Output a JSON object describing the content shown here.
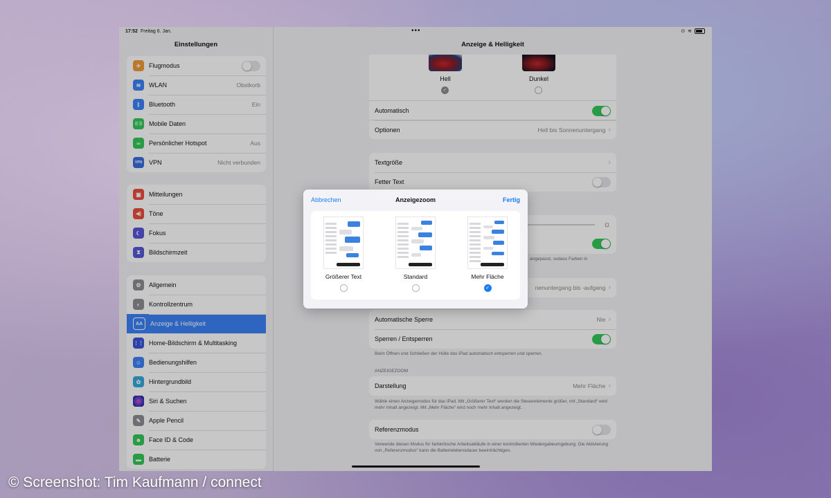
{
  "status_bar": {
    "time": "17:52",
    "date": "Freitag 6. Jan.",
    "dots": "•••"
  },
  "sidebar": {
    "title": "Einstellungen",
    "group1": [
      {
        "label": "Flugmodus",
        "value": "",
        "icon": "airplane-icon",
        "color": "#f09a37",
        "glyph": "✈"
      },
      {
        "label": "WLAN",
        "value": "Obstkorb",
        "icon": "wifi-icon",
        "color": "#3a82f7",
        "glyph": "≋"
      },
      {
        "label": "Bluetooth",
        "value": "Ein",
        "icon": "bluetooth-icon",
        "color": "#3a82f7",
        "glyph": "ᛒ"
      },
      {
        "label": "Mobile Daten",
        "value": "",
        "icon": "antenna-icon",
        "color": "#34c759",
        "glyph": "((·))"
      },
      {
        "label": "Persönlicher Hotspot",
        "value": "Aus",
        "icon": "hotspot-icon",
        "color": "#34c759",
        "glyph": "∞"
      },
      {
        "label": "VPN",
        "value": "Nicht verbunden",
        "icon": "vpn-icon",
        "color": "#3a6de0",
        "glyph": "VPN"
      }
    ],
    "group2": [
      {
        "label": "Mitteilungen",
        "icon": "notifications-icon",
        "color": "#eb4d3d",
        "glyph": "▣"
      },
      {
        "label": "Töne",
        "icon": "speaker-icon",
        "color": "#eb4d3d",
        "glyph": "◀)"
      },
      {
        "label": "Fokus",
        "icon": "moon-icon",
        "color": "#5856d6",
        "glyph": "☾"
      },
      {
        "label": "Bildschirmzeit",
        "icon": "hourglass-icon",
        "color": "#5856d6",
        "glyph": "⧗"
      }
    ],
    "group3": [
      {
        "label": "Allgemein",
        "icon": "gear-icon",
        "color": "#8e8e93",
        "glyph": "⚙"
      },
      {
        "label": "Kontrollzentrum",
        "icon": "toggles-icon",
        "color": "#8e8e93",
        "glyph": "◐"
      },
      {
        "label": "Anzeige & Helligkeit",
        "icon": "display-icon",
        "color": "#3a82f7",
        "glyph": "AA"
      },
      {
        "label": "Home-Bildschirm & Multitasking",
        "icon": "grid-icon",
        "color": "#3a56d6",
        "glyph": "⋮⋮"
      },
      {
        "label": "Bedienungshilfen",
        "icon": "accessibility-icon",
        "color": "#3a82f7",
        "glyph": "☺"
      },
      {
        "label": "Hintergrundbild",
        "icon": "flower-icon",
        "color": "#34aadc",
        "glyph": "✿"
      },
      {
        "label": "Siri & Suchen",
        "icon": "siri-icon",
        "color": "#222222",
        "glyph": "◉"
      },
      {
        "label": "Apple Pencil",
        "icon": "pencil-icon",
        "color": "#8e8e93",
        "glyph": "✎"
      },
      {
        "label": "Face ID & Code",
        "icon": "faceid-icon",
        "color": "#34c759",
        "glyph": "☻"
      },
      {
        "label": "Batterie",
        "icon": "battery-icon",
        "color": "#34c759",
        "glyph": "▬"
      }
    ]
  },
  "detail": {
    "title": "Anzeige & Helligkeit",
    "appearance": {
      "light": "Hell",
      "dark": "Dunkel"
    },
    "auto_label": "Automatisch",
    "options_label": "Optionen",
    "options_value": "Hell bis Sonnenuntergang",
    "textsize_label": "Textgröße",
    "bold_label": "Fetter Text",
    "truetone_footer": "angepasst, sodass Farben in",
    "nightshift_value": "nenuntergang bis -aufgang",
    "autolock_label": "Automatische Sperre",
    "autolock_value": "Nie",
    "lockunlock_label": "Sperren / Entsperren",
    "lockunlock_footer": "Beim Öffnen und Schließen der Hülle das iPad automatisch entsperren und sperren.",
    "zoom_header": "ANZEIGEZOOM",
    "display_label": "Darstellung",
    "display_value": "Mehr Fläche",
    "display_footer": "Wähle einen Anzeigemodus für das iPad. Mit „Größerer Text“ werden die Steuerelemente größer, mit „Standard“ wird mehr Inhalt angezeigt. Mit „Mehr Fläche“ wird noch mehr Inhalt angezeigt.",
    "reference_label": "Referenzmodus",
    "reference_footer": "Verwende diesen Modus für farbkritische Arbeitsabläufe in einer kontrollierten Wiedergabeumgebung. Die Aktivierung von „Referenzmodus“ kann die Batterielebensdauer beeinträchtigen."
  },
  "modal": {
    "cancel": "Abbrechen",
    "title": "Anzeigezoom",
    "done": "Fertig",
    "options": [
      {
        "label": "Größerer Text",
        "selected": false
      },
      {
        "label": "Standard",
        "selected": false
      },
      {
        "label": "Mehr Fläche",
        "selected": true
      }
    ]
  },
  "credit": "© Screenshot: Tim Kaufmann / connect"
}
